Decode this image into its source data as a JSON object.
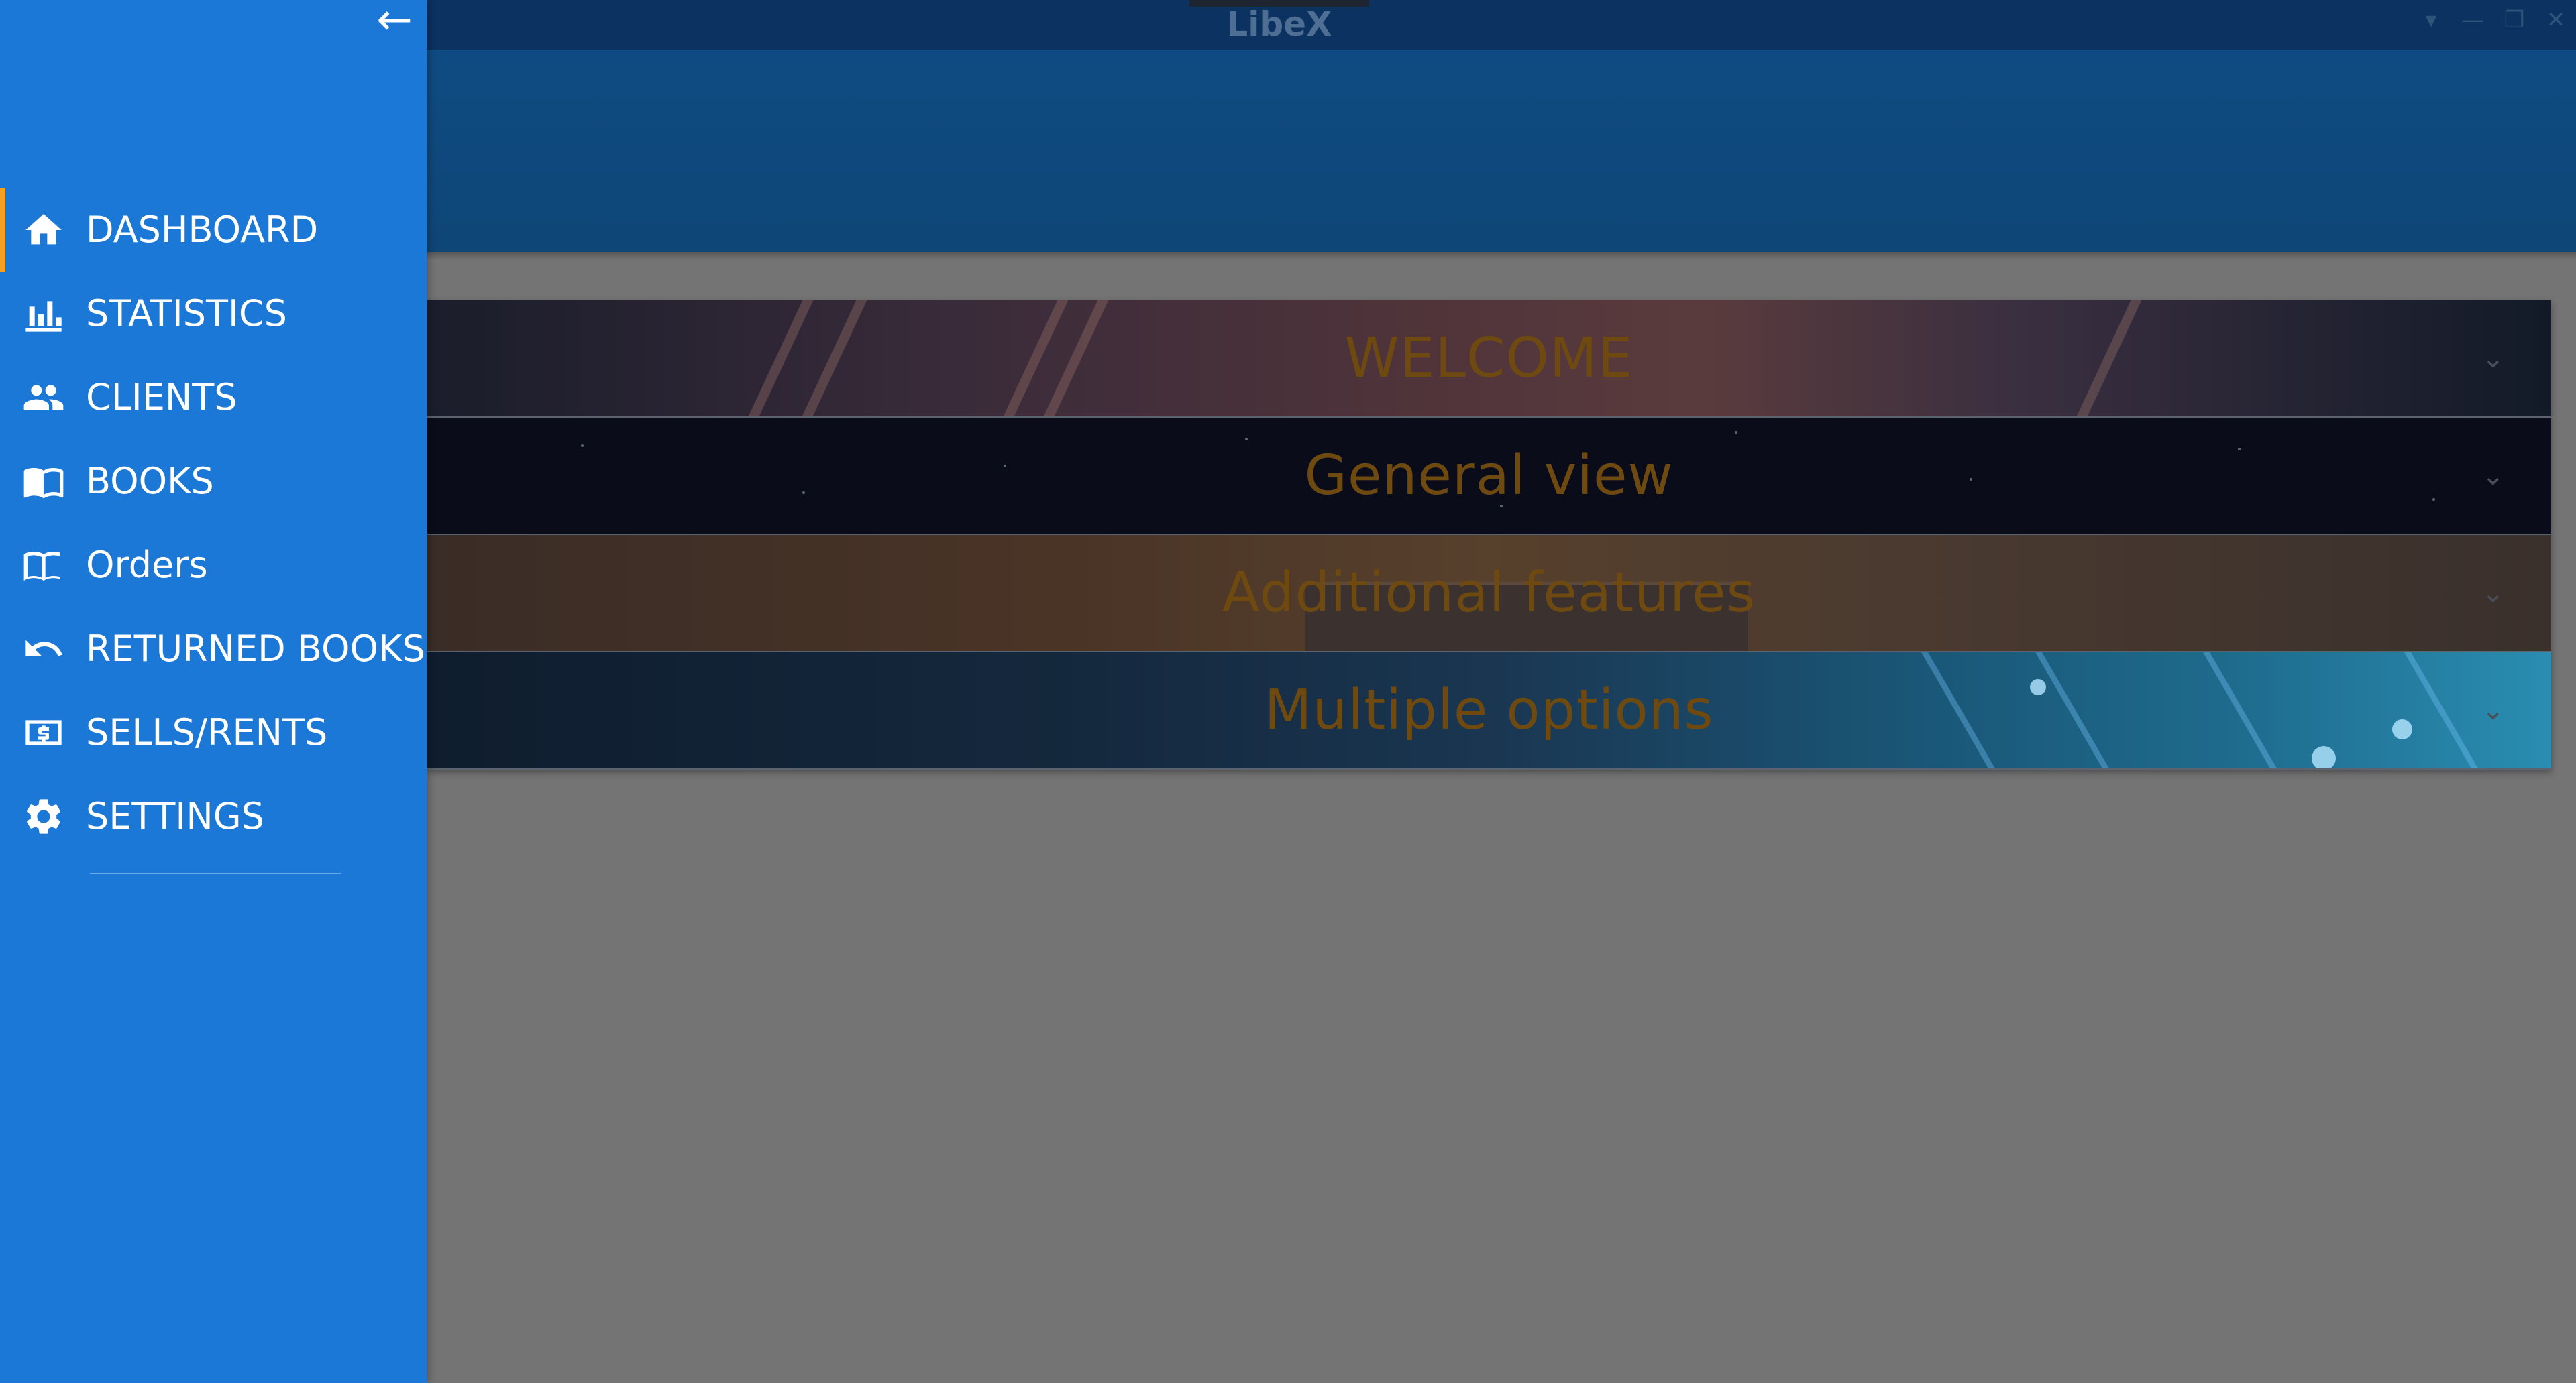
{
  "window": {
    "title": "LibeX",
    "controls": [
      "▾",
      "—",
      "❐",
      "✕"
    ]
  },
  "drawer": {
    "back_icon": "arrow-left-icon",
    "items": [
      {
        "label": "DASHBOARD",
        "icon": "home-icon",
        "active": true
      },
      {
        "label": "STATISTICS",
        "icon": "bar-chart-icon",
        "active": false
      },
      {
        "label": "CLIENTS",
        "icon": "people-icon",
        "active": false
      },
      {
        "label": "BOOKS",
        "icon": "books-icon",
        "active": false
      },
      {
        "label": "Orders",
        "icon": "open-book-icon",
        "active": false
      },
      {
        "label": "RETURNED BOOKS",
        "icon": "undo-icon",
        "active": false
      },
      {
        "label": "SELLS/RENTS",
        "icon": "money-icon",
        "active": false
      },
      {
        "label": "SETTINGS",
        "icon": "gear-icon",
        "active": false
      }
    ]
  },
  "panels": [
    {
      "title": "WELCOME",
      "icon": "chevron-down-icon"
    },
    {
      "title": "General view",
      "icon": "chevron-down-icon"
    },
    {
      "title": "Additional features",
      "icon": "chevron-down-icon"
    },
    {
      "title": "Multiple options",
      "icon": "chevron-down-icon"
    }
  ],
  "colors": {
    "drawer": "#1c78d6",
    "active_indicator": "#f4a020",
    "header": "#0f4b82",
    "titlebar": "#0b3261",
    "panel_title": "#6e4a10",
    "background": "#747474"
  }
}
